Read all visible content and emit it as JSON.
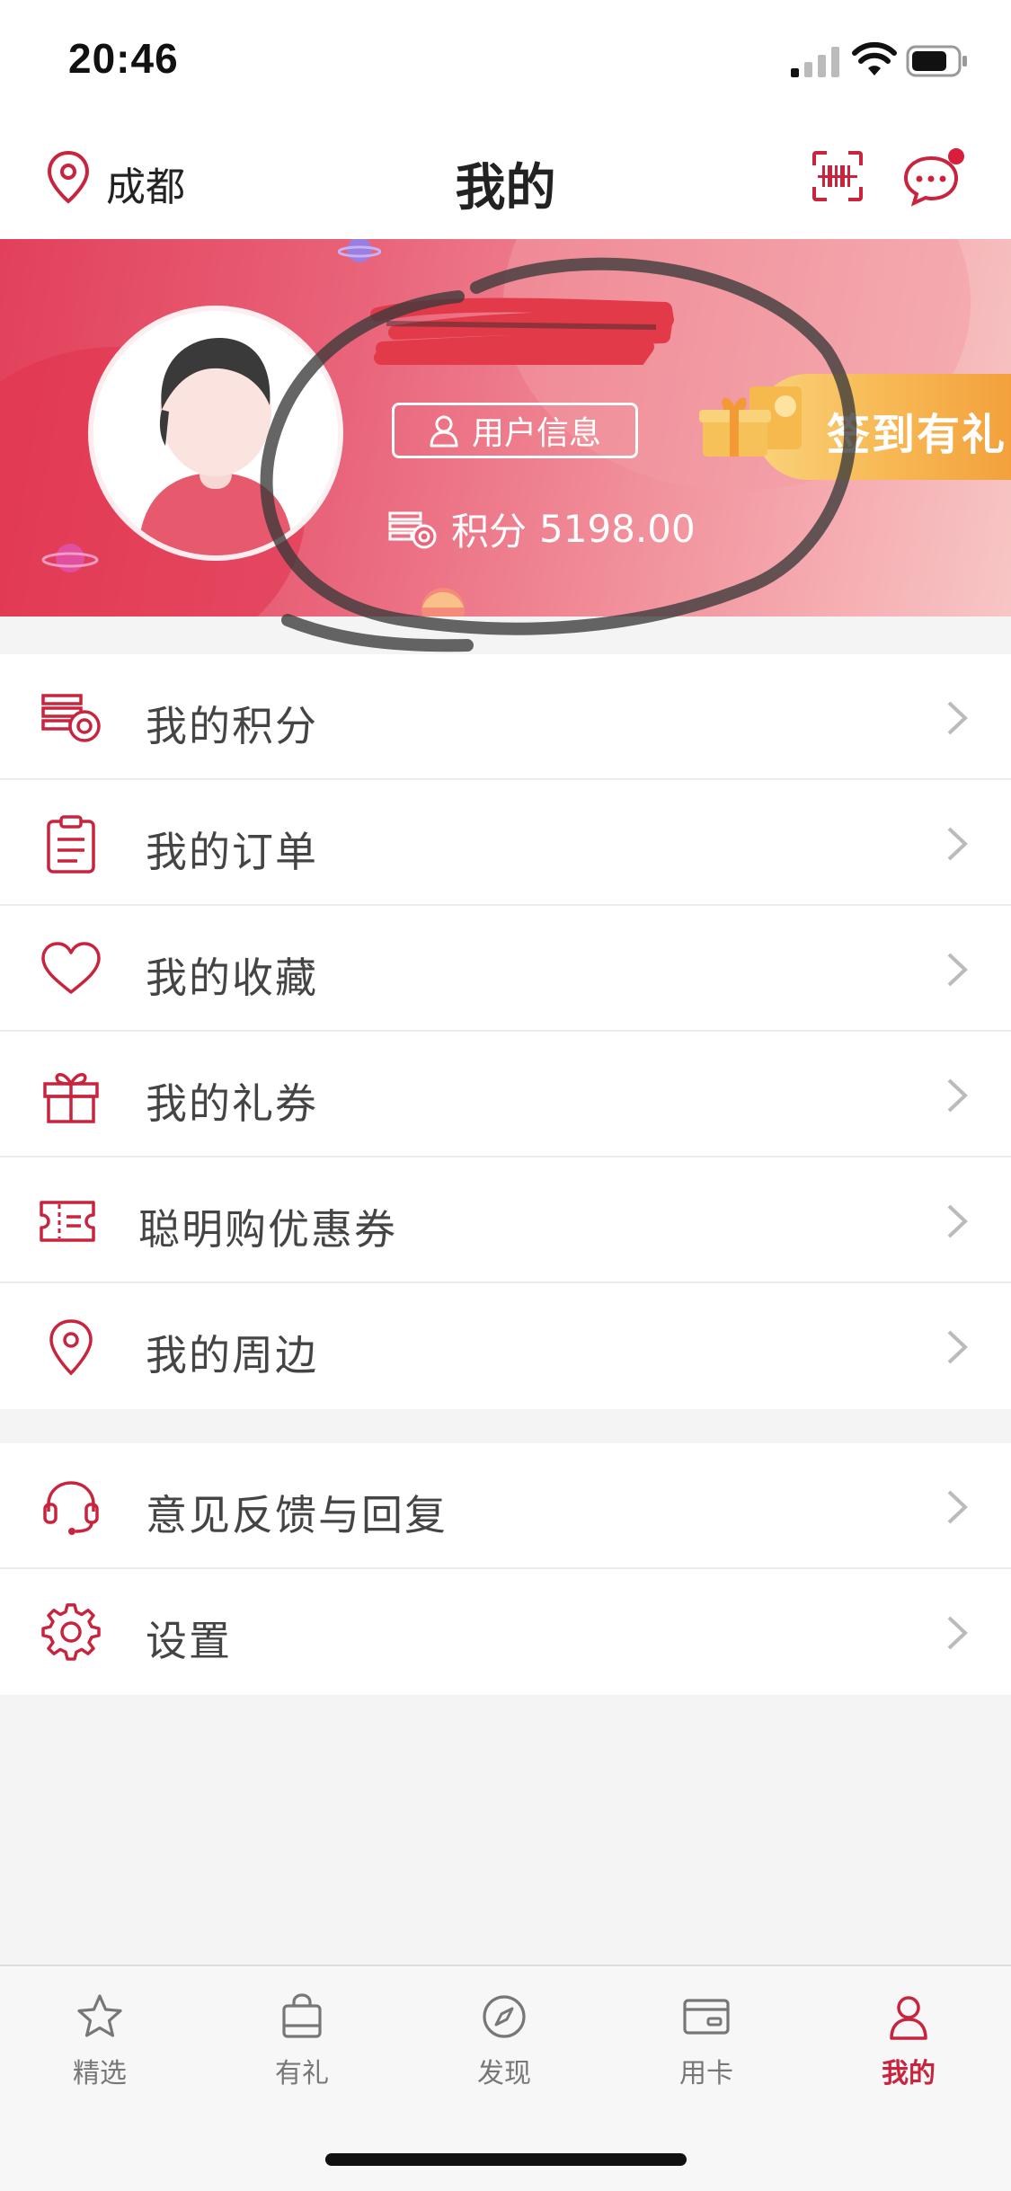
{
  "status_bar": {
    "time": "20:46"
  },
  "nav": {
    "city": "成都",
    "title": "我的"
  },
  "profile": {
    "user_info_label": "用户信息",
    "points_label": "积分",
    "points_value": "5198.00",
    "signin_label": "签到有礼"
  },
  "menu_group1": [
    {
      "label": "我的积分",
      "icon": "points-icon"
    },
    {
      "label": "我的订单",
      "icon": "clipboard-icon"
    },
    {
      "label": "我的收藏",
      "icon": "heart-icon"
    },
    {
      "label": "我的礼券",
      "icon": "gift-icon"
    },
    {
      "label": "聪明购优惠券",
      "icon": "coupon-icon"
    },
    {
      "label": "我的周边",
      "icon": "location-pin-icon"
    }
  ],
  "menu_group2": [
    {
      "label": "意见反馈与回复",
      "icon": "headset-icon"
    },
    {
      "label": "设置",
      "icon": "gear-icon"
    }
  ],
  "tabbar": {
    "items": [
      {
        "label": "精选",
        "icon": "star-icon"
      },
      {
        "label": "有礼",
        "icon": "bag-icon"
      },
      {
        "label": "发现",
        "icon": "compass-icon"
      },
      {
        "label": "用卡",
        "icon": "card-icon"
      },
      {
        "label": "我的",
        "icon": "user-icon"
      }
    ],
    "active_index": 4
  },
  "colors": {
    "accent": "#c8243e",
    "banner_start": "#e2405a",
    "banner_end": "#f7c6c4",
    "signin": "#f7b955"
  }
}
